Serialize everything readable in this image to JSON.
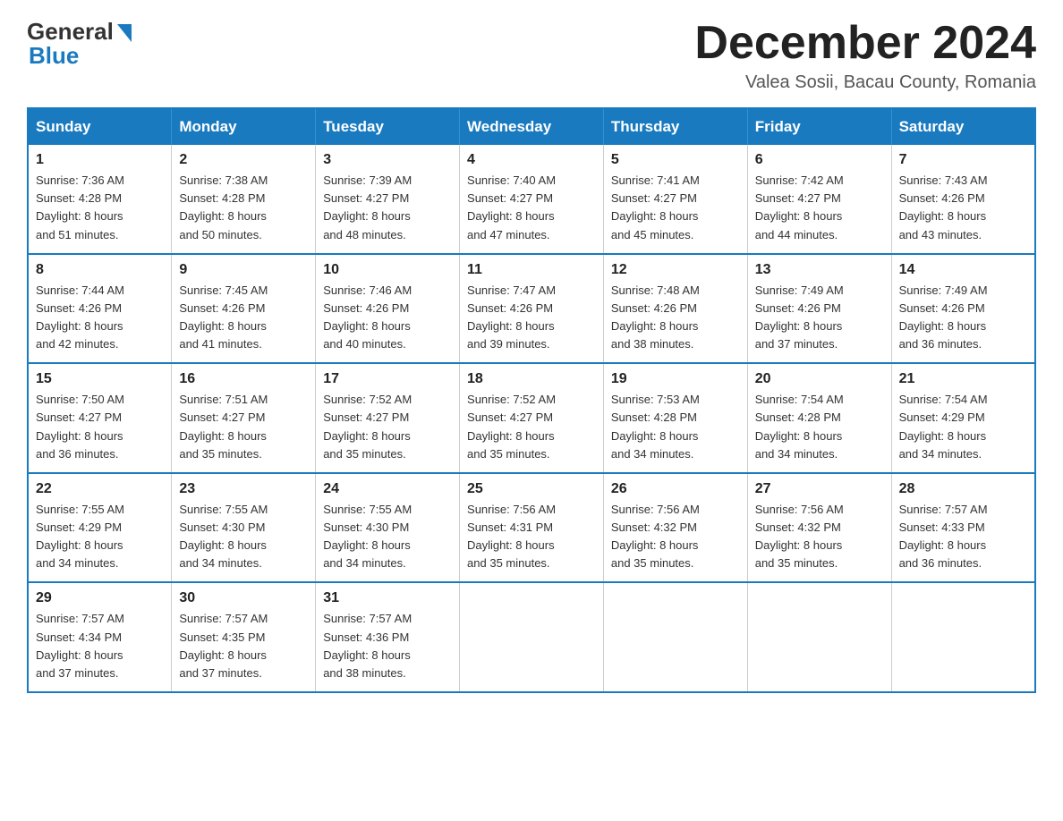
{
  "header": {
    "logo_general": "General",
    "logo_blue": "Blue",
    "month_title": "December 2024",
    "location": "Valea Sosii, Bacau County, Romania"
  },
  "weekdays": [
    "Sunday",
    "Monday",
    "Tuesday",
    "Wednesday",
    "Thursday",
    "Friday",
    "Saturday"
  ],
  "weeks": [
    [
      {
        "day": "1",
        "sunrise": "7:36 AM",
        "sunset": "4:28 PM",
        "daylight": "8 hours and 51 minutes."
      },
      {
        "day": "2",
        "sunrise": "7:38 AM",
        "sunset": "4:28 PM",
        "daylight": "8 hours and 50 minutes."
      },
      {
        "day": "3",
        "sunrise": "7:39 AM",
        "sunset": "4:27 PM",
        "daylight": "8 hours and 48 minutes."
      },
      {
        "day": "4",
        "sunrise": "7:40 AM",
        "sunset": "4:27 PM",
        "daylight": "8 hours and 47 minutes."
      },
      {
        "day": "5",
        "sunrise": "7:41 AM",
        "sunset": "4:27 PM",
        "daylight": "8 hours and 45 minutes."
      },
      {
        "day": "6",
        "sunrise": "7:42 AM",
        "sunset": "4:27 PM",
        "daylight": "8 hours and 44 minutes."
      },
      {
        "day": "7",
        "sunrise": "7:43 AM",
        "sunset": "4:26 PM",
        "daylight": "8 hours and 43 minutes."
      }
    ],
    [
      {
        "day": "8",
        "sunrise": "7:44 AM",
        "sunset": "4:26 PM",
        "daylight": "8 hours and 42 minutes."
      },
      {
        "day": "9",
        "sunrise": "7:45 AM",
        "sunset": "4:26 PM",
        "daylight": "8 hours and 41 minutes."
      },
      {
        "day": "10",
        "sunrise": "7:46 AM",
        "sunset": "4:26 PM",
        "daylight": "8 hours and 40 minutes."
      },
      {
        "day": "11",
        "sunrise": "7:47 AM",
        "sunset": "4:26 PM",
        "daylight": "8 hours and 39 minutes."
      },
      {
        "day": "12",
        "sunrise": "7:48 AM",
        "sunset": "4:26 PM",
        "daylight": "8 hours and 38 minutes."
      },
      {
        "day": "13",
        "sunrise": "7:49 AM",
        "sunset": "4:26 PM",
        "daylight": "8 hours and 37 minutes."
      },
      {
        "day": "14",
        "sunrise": "7:49 AM",
        "sunset": "4:26 PM",
        "daylight": "8 hours and 36 minutes."
      }
    ],
    [
      {
        "day": "15",
        "sunrise": "7:50 AM",
        "sunset": "4:27 PM",
        "daylight": "8 hours and 36 minutes."
      },
      {
        "day": "16",
        "sunrise": "7:51 AM",
        "sunset": "4:27 PM",
        "daylight": "8 hours and 35 minutes."
      },
      {
        "day": "17",
        "sunrise": "7:52 AM",
        "sunset": "4:27 PM",
        "daylight": "8 hours and 35 minutes."
      },
      {
        "day": "18",
        "sunrise": "7:52 AM",
        "sunset": "4:27 PM",
        "daylight": "8 hours and 35 minutes."
      },
      {
        "day": "19",
        "sunrise": "7:53 AM",
        "sunset": "4:28 PM",
        "daylight": "8 hours and 34 minutes."
      },
      {
        "day": "20",
        "sunrise": "7:54 AM",
        "sunset": "4:28 PM",
        "daylight": "8 hours and 34 minutes."
      },
      {
        "day": "21",
        "sunrise": "7:54 AM",
        "sunset": "4:29 PM",
        "daylight": "8 hours and 34 minutes."
      }
    ],
    [
      {
        "day": "22",
        "sunrise": "7:55 AM",
        "sunset": "4:29 PM",
        "daylight": "8 hours and 34 minutes."
      },
      {
        "day": "23",
        "sunrise": "7:55 AM",
        "sunset": "4:30 PM",
        "daylight": "8 hours and 34 minutes."
      },
      {
        "day": "24",
        "sunrise": "7:55 AM",
        "sunset": "4:30 PM",
        "daylight": "8 hours and 34 minutes."
      },
      {
        "day": "25",
        "sunrise": "7:56 AM",
        "sunset": "4:31 PM",
        "daylight": "8 hours and 35 minutes."
      },
      {
        "day": "26",
        "sunrise": "7:56 AM",
        "sunset": "4:32 PM",
        "daylight": "8 hours and 35 minutes."
      },
      {
        "day": "27",
        "sunrise": "7:56 AM",
        "sunset": "4:32 PM",
        "daylight": "8 hours and 35 minutes."
      },
      {
        "day": "28",
        "sunrise": "7:57 AM",
        "sunset": "4:33 PM",
        "daylight": "8 hours and 36 minutes."
      }
    ],
    [
      {
        "day": "29",
        "sunrise": "7:57 AM",
        "sunset": "4:34 PM",
        "daylight": "8 hours and 37 minutes."
      },
      {
        "day": "30",
        "sunrise": "7:57 AM",
        "sunset": "4:35 PM",
        "daylight": "8 hours and 37 minutes."
      },
      {
        "day": "31",
        "sunrise": "7:57 AM",
        "sunset": "4:36 PM",
        "daylight": "8 hours and 38 minutes."
      },
      null,
      null,
      null,
      null
    ]
  ]
}
